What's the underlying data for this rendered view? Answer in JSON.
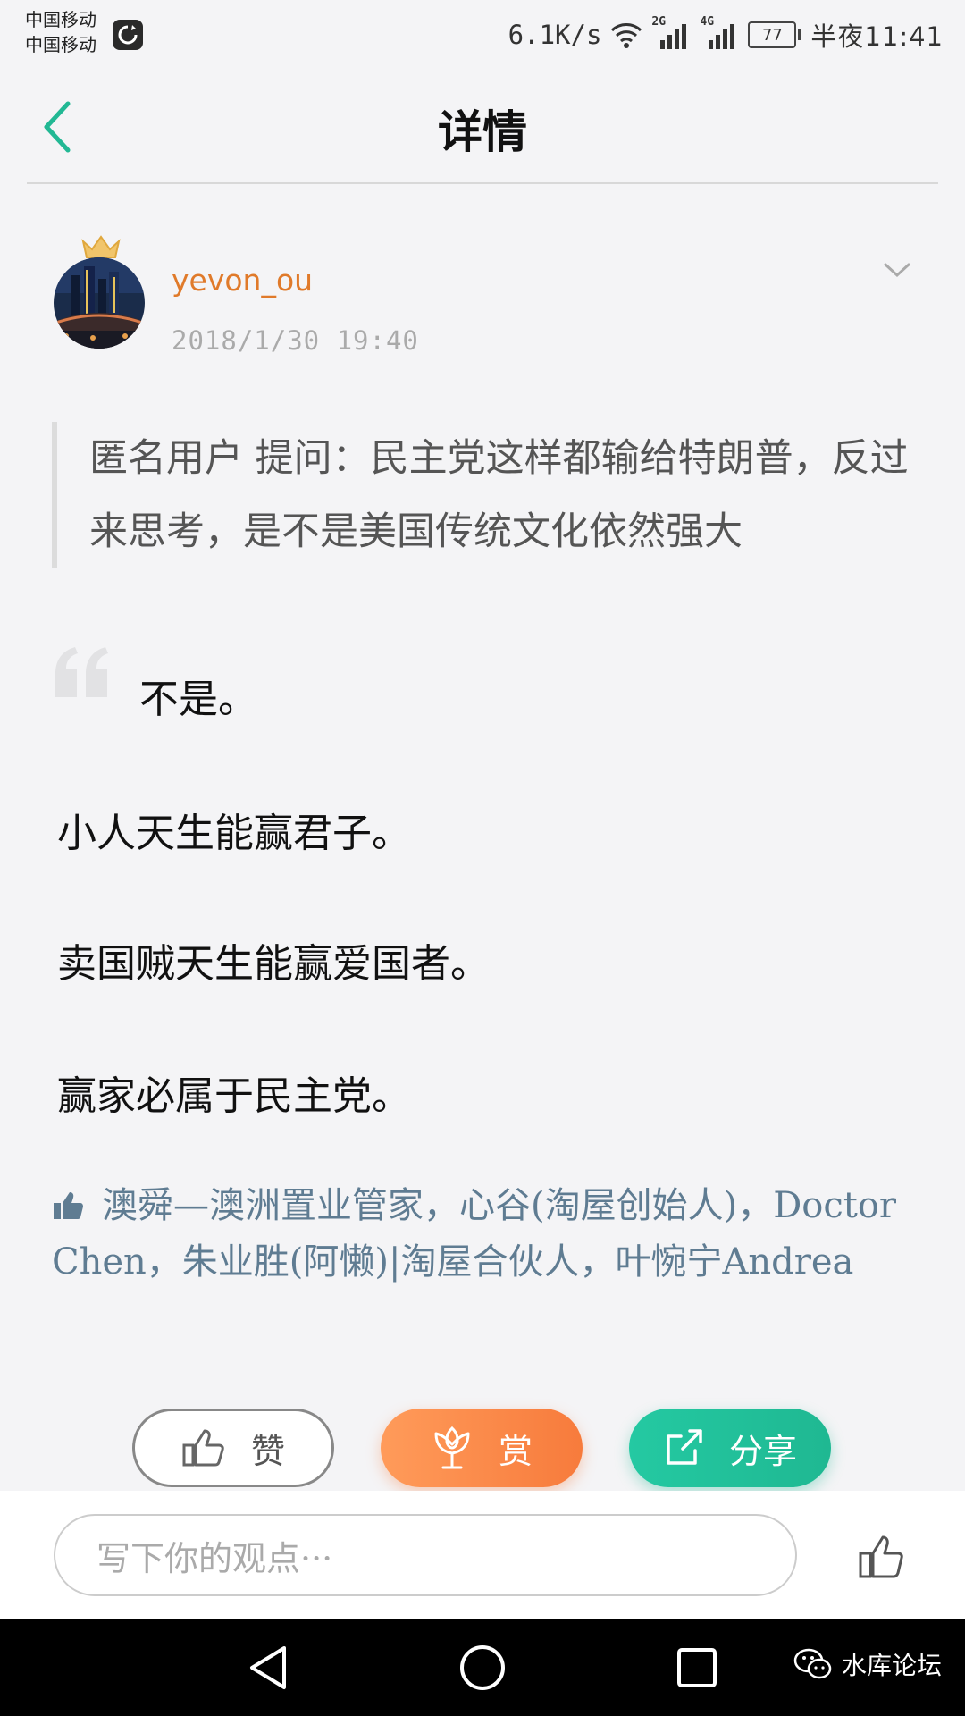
{
  "status_bar": {
    "carrier_1": "中国移动",
    "carrier_2": "中国移动",
    "net_speed": "6.1K/s",
    "sim1_type": "2G",
    "sim2_type": "4G",
    "battery": "77",
    "time": "半夜11:41"
  },
  "header": {
    "title": "详情"
  },
  "post": {
    "author": "yevon_ou",
    "time": "2018/1/30 19:40",
    "question": "匿名用户  提问：民主党这样都输给特朗普，反过来思考，是不是美国传统文化依然强大",
    "answer_lines": [
      "不是。",
      "小人天生能赢君子。",
      "卖国贼天生能赢爱国者。",
      "赢家必属于民主党。"
    ],
    "likes": "澳舜—澳洲置业管家，心谷(淘屋创始人)，Doctor Chen，朱业胜(阿懒)|淘屋合伙人，叶惋宁Andrea"
  },
  "actions": {
    "like": "赞",
    "reward": "赏",
    "share": "分享"
  },
  "comment": {
    "placeholder": "写下你的观点···"
  },
  "watermark": {
    "text": "水库论坛"
  },
  "colors": {
    "accent_green": "#1fb892",
    "accent_orange": "#f77b3c",
    "username": "#e07a2a",
    "link": "#5f7c92"
  }
}
